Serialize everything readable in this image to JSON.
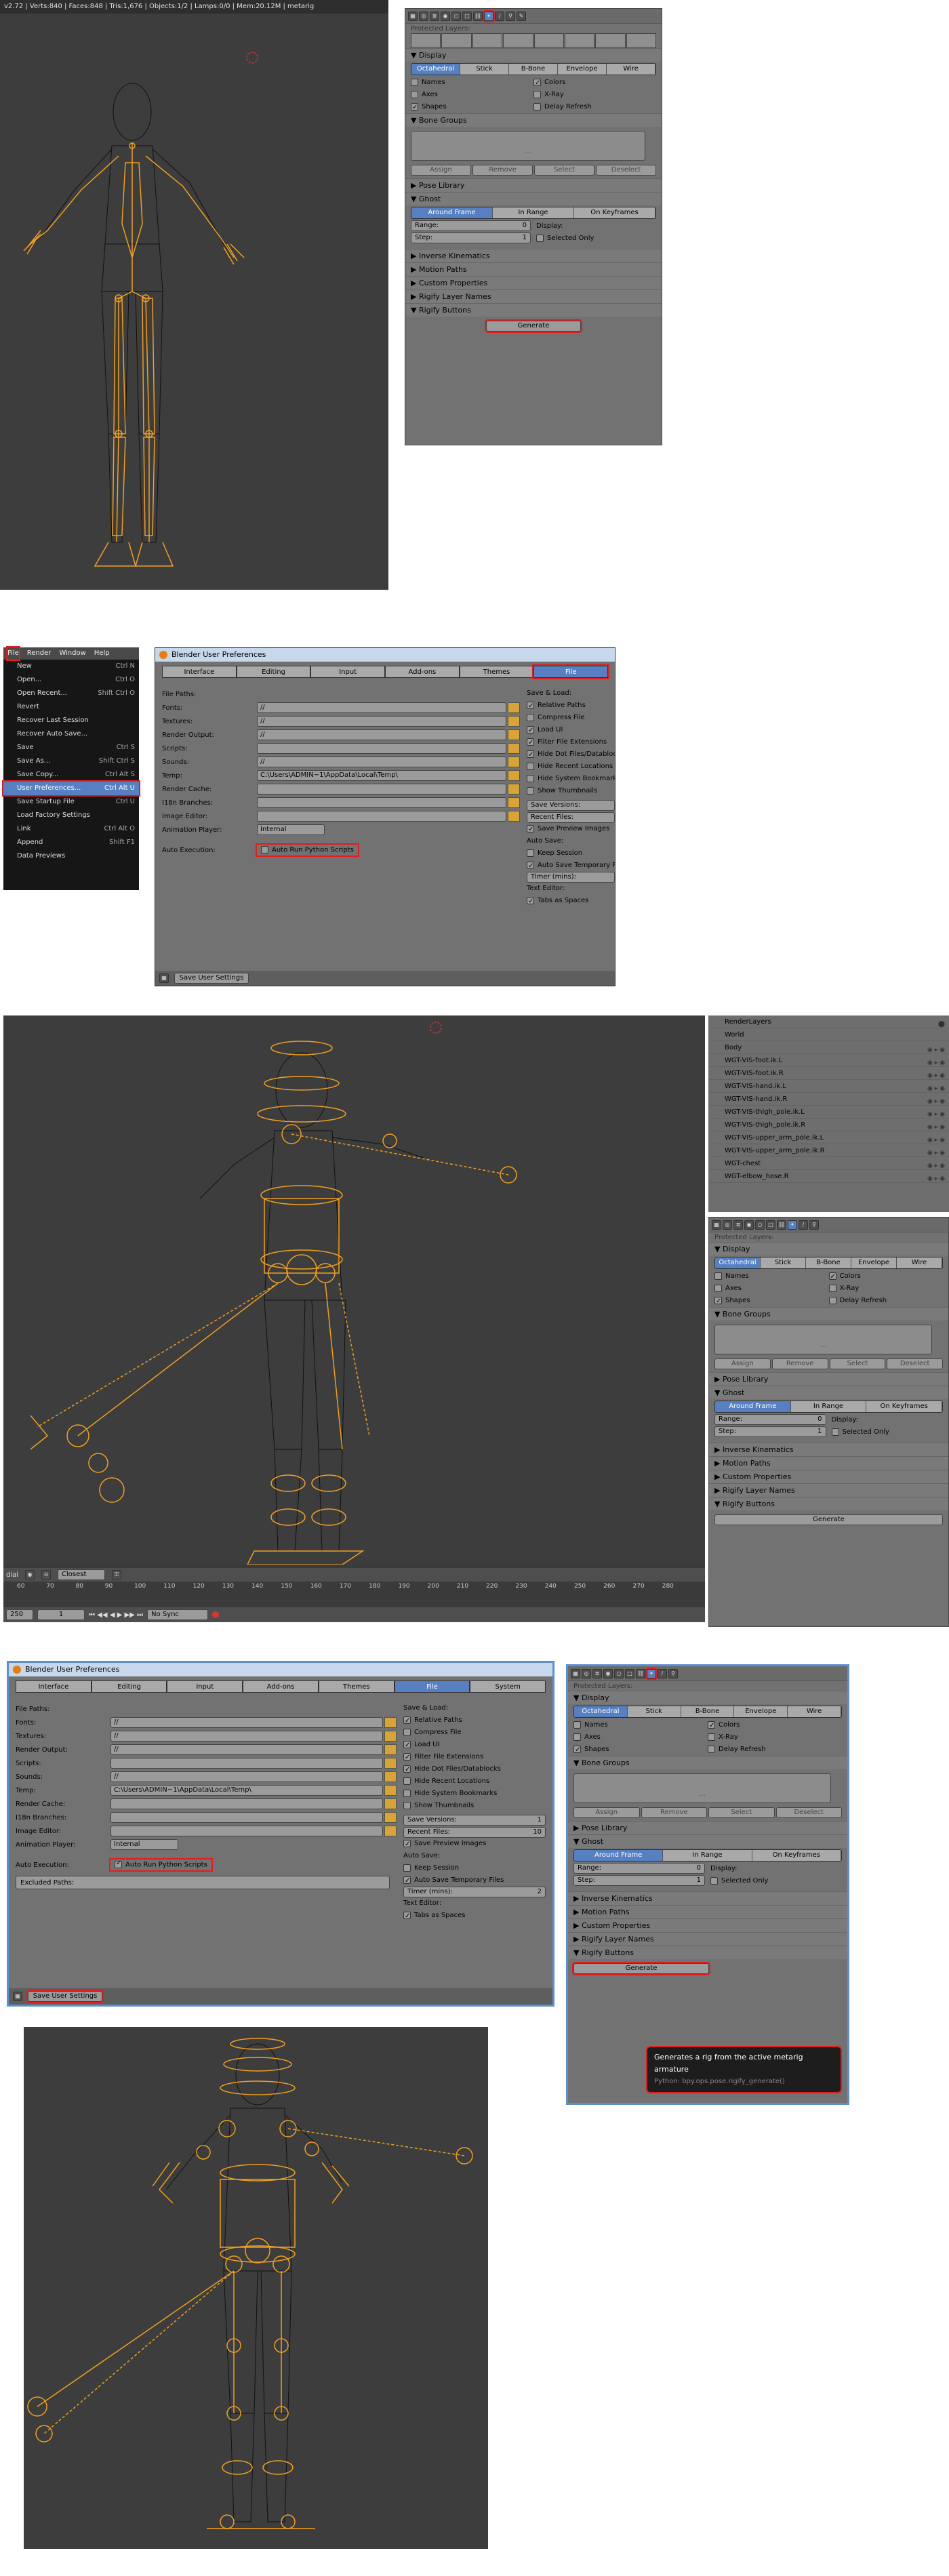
{
  "vp1": {
    "header": "v2.72 | Verts:840 | Faces:848 | Tris:1,676 | Objects:1/2 | Lamps:0/0 | Mem:20.12M | metarig"
  },
  "panel": {
    "protected_layers": "Protected Layers:",
    "display_header": "Display",
    "display_modes": [
      "Octahedral",
      "Stick",
      "B-Bone",
      "Envelope",
      "Wire"
    ],
    "display_active": "Octahedral",
    "opts_left": [
      {
        "label": "Names",
        "checked": false
      },
      {
        "label": "Axes",
        "checked": false
      },
      {
        "label": "Shapes",
        "checked": true
      }
    ],
    "opts_right": [
      {
        "label": "Colors",
        "checked": true
      },
      {
        "label": "X-Ray",
        "checked": false
      },
      {
        "label": "Delay Refresh",
        "checked": false
      }
    ],
    "bone_groups": "Bone Groups",
    "bg_buttons": [
      "Assign",
      "Remove",
      "Select",
      "Deselect"
    ],
    "pose_library": "Pose Library",
    "ghost": "Ghost",
    "ghost_modes": [
      "Around Frame",
      "In Range",
      "On Keyframes"
    ],
    "ghost_active": "Around Frame",
    "range_label": "Range:",
    "range_val": "0",
    "step_label": "Step:",
    "step_val": "1",
    "display_label": "Display:",
    "selected_only": "Selected Only",
    "collapsed": [
      "Inverse Kinematics",
      "Motion Paths",
      "Custom Properties",
      "Rigify Layer Names",
      "Rigify Buttons"
    ],
    "generate": "Generate"
  },
  "file_menu": {
    "top": [
      "File",
      "Render",
      "Window",
      "Help"
    ],
    "items": [
      {
        "label": "New",
        "key": "Ctrl N"
      },
      {
        "label": "Open...",
        "key": "Ctrl O"
      },
      {
        "label": "Open Recent...",
        "key": "Shift Ctrl O"
      },
      {
        "label": "Revert",
        "key": ""
      },
      {
        "label": "Recover Last Session",
        "key": ""
      },
      {
        "label": "Recover Auto Save...",
        "key": ""
      },
      {
        "label": "Save",
        "key": "Ctrl S"
      },
      {
        "label": "Save As...",
        "key": "Shift Ctrl S"
      },
      {
        "label": "Save Copy...",
        "key": "Ctrl Alt S"
      },
      {
        "label": "User Preferences...",
        "key": "Ctrl Alt U"
      },
      {
        "label": "Save Startup File",
        "key": "Ctrl U"
      },
      {
        "label": "Load Factory Settings",
        "key": ""
      },
      {
        "label": "Link",
        "key": "Ctrl Alt O"
      },
      {
        "label": "Append",
        "key": "Shift F1"
      },
      {
        "label": "Data Previews",
        "key": ""
      }
    ]
  },
  "prefs": {
    "title": "Blender User Preferences",
    "tabs": [
      "Interface",
      "Editing",
      "Input",
      "Add-ons",
      "Themes",
      "File",
      "System"
    ],
    "active_tab": "File",
    "file_paths": "File Paths:",
    "paths": [
      {
        "label": "Fonts:",
        "value": "//"
      },
      {
        "label": "Textures:",
        "value": "//"
      },
      {
        "label": "Render Output:",
        "value": "//"
      },
      {
        "label": "Scripts:",
        "value": ""
      },
      {
        "label": "Sounds:",
        "value": "//"
      },
      {
        "label": "Temp:",
        "value": "C:\\Users\\ADMIN~1\\AppData\\Local\\Temp\\"
      },
      {
        "label": "Render Cache:",
        "value": ""
      },
      {
        "label": "I18n Branches:",
        "value": ""
      },
      {
        "label": "Image Editor:",
        "value": ""
      }
    ],
    "anim_player": "Animation Player:",
    "anim_value": "Internal",
    "auto_exec": "Auto Execution:",
    "auto_run": "Auto Run Python Scripts",
    "excluded": "Excluded Paths:",
    "save_load": "Save & Load:",
    "sl_opts": [
      {
        "label": "Relative Paths",
        "checked": true
      },
      {
        "label": "Compress File",
        "checked": false
      },
      {
        "label": "Load UI",
        "checked": true
      },
      {
        "label": "Filter File Extensions",
        "checked": true
      },
      {
        "label": "Hide Dot Files/Datablocks",
        "checked": true
      },
      {
        "label": "Hide Recent Locations",
        "checked": false
      },
      {
        "label": "Hide System Bookmarks",
        "checked": false
      },
      {
        "label": "Show Thumbnails",
        "checked": false
      }
    ],
    "save_versions": "Save Versions:",
    "save_versions_val": "1",
    "recent_files": "Recent Files:",
    "recent_files_val": "10",
    "save_preview": "Save Preview Images",
    "auto_save": "Auto Save:",
    "keep_session": "Keep Session",
    "auto_save_temp": "Auto Save Temporary Files",
    "timer": "Timer (mins):",
    "timer_val": "2",
    "text_editor": "Text Editor:",
    "tabs_as_spaces": "Tabs as Spaces",
    "save_user": "Save User Settings"
  },
  "outliner": {
    "rows": [
      "RenderLayers",
      "World",
      "Body",
      "WGT-VIS-foot.ik.L",
      "WGT-VIS-foot.ik.R",
      "WGT-VIS-hand.ik.L",
      "WGT-VIS-hand.ik.R",
      "WGT-VIS-thigh_pole.ik.L",
      "WGT-VIS-thigh_pole.ik.R",
      "WGT-VIS-upper_arm_pole.ik.L",
      "WGT-VIS-upper_arm_pole.ik.R",
      "WGT-chest",
      "WGT-elbow_hose.R"
    ]
  },
  "timeline": {
    "ticks": [
      "60",
      "70",
      "80",
      "90",
      "100",
      "110",
      "120",
      "130",
      "140",
      "150",
      "160",
      "170",
      "180",
      "190",
      "200",
      "210",
      "220",
      "230",
      "240",
      "250",
      "260",
      "270",
      "280"
    ],
    "menu_label": "Closest",
    "end": "250",
    "cur": "1",
    "sync": "No Sync",
    "view_label": "dial"
  },
  "tooltip": {
    "text": "Generates a rig from the active metarig armature",
    "python": "Python: bpy.ops.pose.rigify_generate()"
  }
}
